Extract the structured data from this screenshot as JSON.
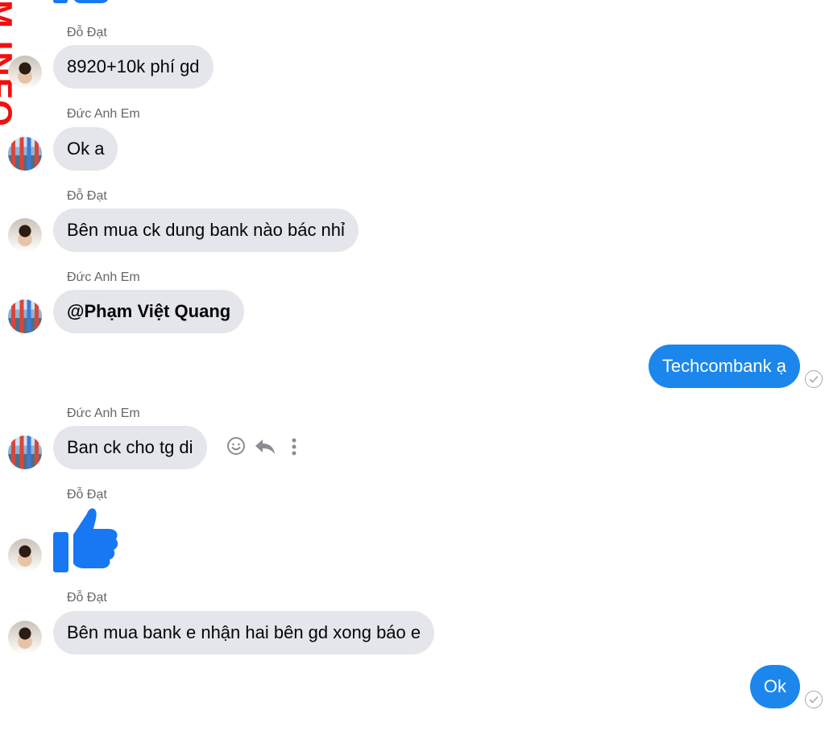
{
  "watermark": "M.INFO",
  "messages": [
    {
      "sender": "Đỗ Đạt",
      "text": "8920+10k phí gd"
    },
    {
      "sender": "Đức Anh Em",
      "text": "Ok a"
    },
    {
      "sender": "Đỗ Đạt",
      "text": "Bên mua ck dung bank nào bác nhỉ"
    },
    {
      "sender": "Đức Anh Em",
      "text": "@Phạm Việt Quang"
    },
    {
      "sender": "me",
      "text": "Techcombank ạ"
    },
    {
      "sender": "Đức Anh Em",
      "text": "Ban ck cho tg di"
    },
    {
      "sender": "Đỗ Đạt",
      "text": "thumbs-up"
    },
    {
      "sender": "Đỗ Đạt",
      "text": "Bên mua bank e nhận hai bên gd xong báo e"
    },
    {
      "sender": "me",
      "text": "Ok"
    }
  ],
  "message_actions": [
    "smiley-icon",
    "reply-icon",
    "more-options-icon"
  ],
  "colors": {
    "incoming_bubble": "#e4e6eb",
    "outgoing_bubble": "#1b87ed",
    "accent": "#1877f2",
    "sender_text": "#65676b",
    "watermark": "#f10f0f"
  }
}
